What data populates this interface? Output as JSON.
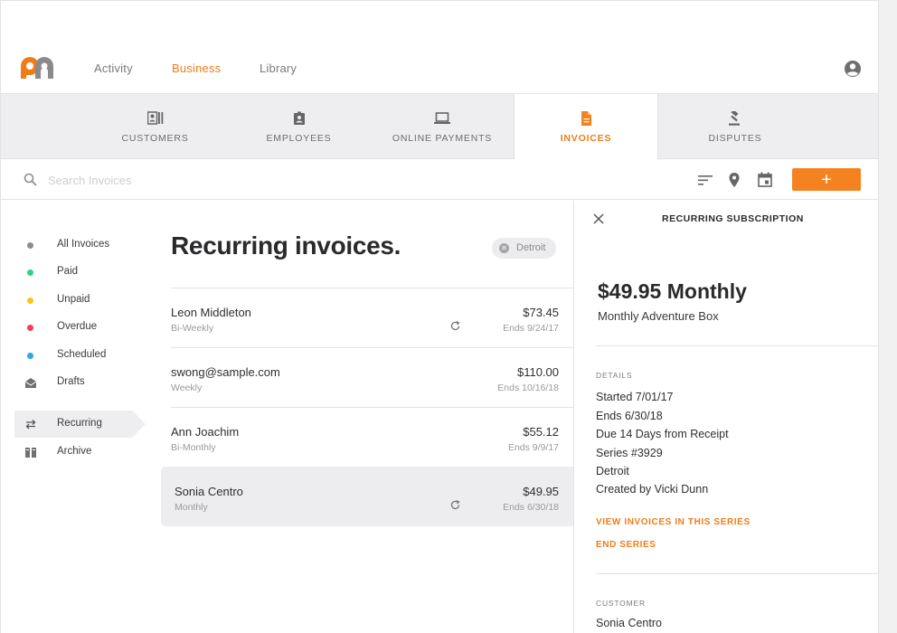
{
  "nav": {
    "links": [
      "Activity",
      "Business",
      "Library"
    ],
    "active": "Business"
  },
  "tabs": [
    {
      "label": "CUSTOMERS",
      "icon": "customers-icon"
    },
    {
      "label": "EMPLOYEES",
      "icon": "employee-badge-icon"
    },
    {
      "label": "ONLINE PAYMENTS",
      "icon": "laptop-icon"
    },
    {
      "label": "INVOICES",
      "icon": "document-icon"
    },
    {
      "label": "DISPUTES",
      "icon": "gavel-icon"
    }
  ],
  "active_tab": "INVOICES",
  "search": {
    "placeholder": "Search Invoices"
  },
  "add_button_label": "+",
  "sidebar": {
    "items": [
      {
        "label": "All Invoices",
        "dot_color": "#8e8e92"
      },
      {
        "label": "Paid",
        "dot_color": "#2fd18a"
      },
      {
        "label": "Unpaid",
        "dot_color": "#f5c518"
      },
      {
        "label": "Overdue",
        "dot_color": "#ef3f5a"
      },
      {
        "label": "Scheduled",
        "dot_color": "#29a9e1"
      },
      {
        "label": "Drafts",
        "icon": "envelope-open-icon"
      },
      {
        "label": "Recurring",
        "icon": "repeat-icon"
      },
      {
        "label": "Archive",
        "icon": "archive-icon"
      }
    ],
    "active": "Recurring"
  },
  "main": {
    "title": "Recurring invoices.",
    "filter_chip": "Detroit",
    "rows": [
      {
        "name": "Leon Middleton",
        "frequency": "Bi-Weekly",
        "amount": "$73.45",
        "ends": "Ends 9/24/17",
        "has_refresh": true
      },
      {
        "name": "swong@sample.com",
        "frequency": "Weekly",
        "amount": "$110.00",
        "ends": "Ends 10/16/18",
        "has_refresh": false
      },
      {
        "name": "Ann Joachim",
        "frequency": "Bi-Monthly",
        "amount": "$55.12",
        "ends": "Ends 9/9/17",
        "has_refresh": false
      },
      {
        "name": "Sonia Centro",
        "frequency": "Monthly",
        "amount": "$49.95",
        "ends": "Ends 6/30/18",
        "has_refresh": true
      }
    ],
    "selected_row": "Sonia Centro"
  },
  "detail": {
    "heading": "RECURRING SUBSCRIPTION",
    "price": "$49.95 Monthly",
    "product": "Monthly Adventure Box",
    "details_label": "DETAILS",
    "details": [
      "Started 7/01/17",
      "Ends 6/30/18",
      "Due 14 Days from Receipt",
      "Series #3929",
      "Detroit",
      "Created by Vicki Dunn"
    ],
    "link_view_series": "VIEW INVOICES IN THIS SERIES",
    "link_end_series": "END SERIES",
    "customer_label": "CUSTOMER",
    "customer_name": "Sonia Centro"
  },
  "colors": {
    "accent": "#f07c18",
    "button": "#f58220"
  }
}
